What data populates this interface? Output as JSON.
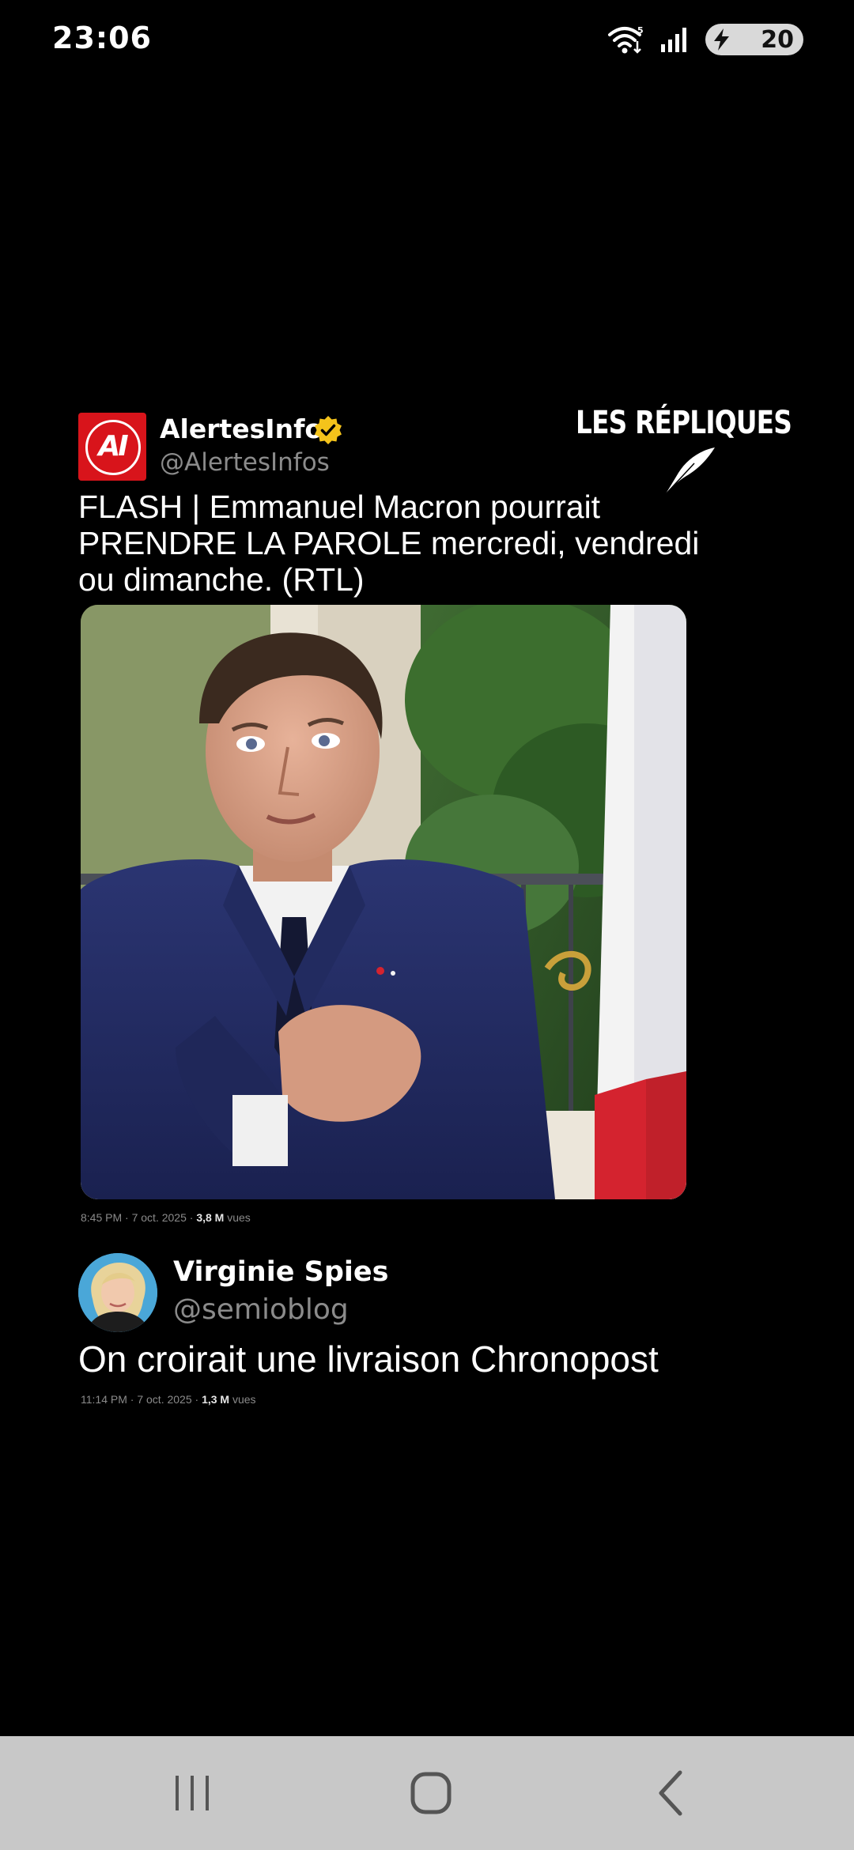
{
  "status_bar": {
    "time": "23:06",
    "battery_level": "20",
    "icons": [
      "wifi-icon",
      "signal-icon",
      "battery-charging-icon"
    ]
  },
  "tweet1": {
    "author_name": "AlertesInfos",
    "handle": "@AlertesInfos",
    "avatar_text": "AI",
    "verified": true,
    "text_lines": [
      "FLASH | Emmanuel Macron pourrait",
      "PRENDRE LA PAROLE mercredi, vendredi",
      "ou dimanche. (RTL)"
    ],
    "time": "8:45 PM",
    "date": "7 oct. 2025",
    "views_count": "3,8 M",
    "views_label": "vues",
    "separator": "·"
  },
  "brand": {
    "name": "LES RÉPLIQUES"
  },
  "tweet2": {
    "author_name": "Virginie Spies",
    "handle": "@semioblog",
    "text": "On croirait une livraison Chronopost",
    "time": "11:14 PM",
    "date": "7 oct. 2025",
    "views_count": "1,3 M",
    "views_label": "vues",
    "separator": "·"
  },
  "nav": {
    "icons": [
      "recent-apps-icon",
      "home-icon",
      "back-icon"
    ]
  },
  "colors": {
    "background": "#000000",
    "avatar_red": "#d8141b",
    "verified_gold": "#f4c31b",
    "handle_gray": "#8b8b8b",
    "nav_bar": "#c8c8c8"
  }
}
